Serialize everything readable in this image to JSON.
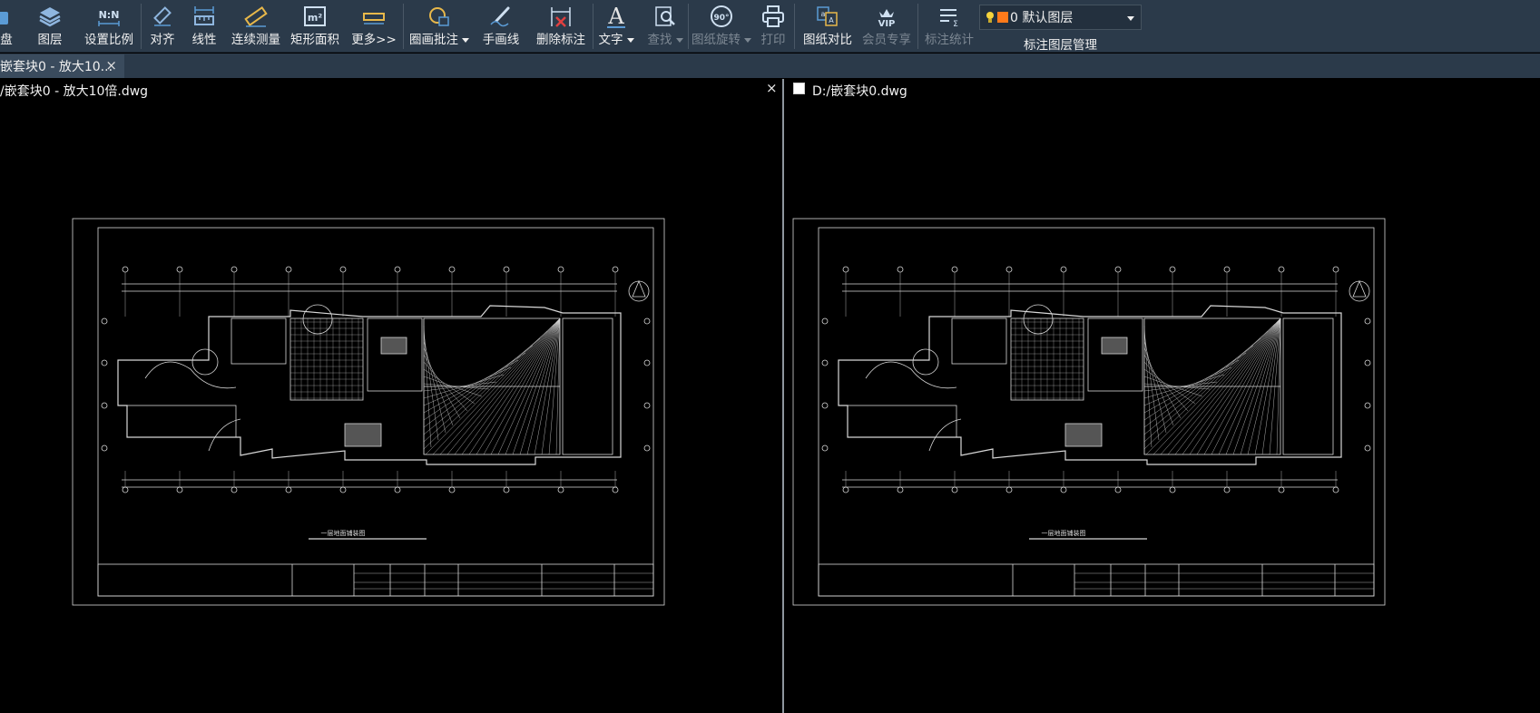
{
  "toolbar": {
    "items": [
      {
        "label": "盘",
        "icon": "disk-icon"
      },
      {
        "label": "图层",
        "icon": "layers-icon"
      },
      {
        "label": "设置比例",
        "icon": "scale-icon",
        "icon_text": "N:N"
      },
      {
        "label": "对齐",
        "icon": "align-icon"
      },
      {
        "label": "线性",
        "icon": "linear-dimension-icon"
      },
      {
        "label": "连续测量",
        "icon": "continuous-measure-icon"
      },
      {
        "label": "矩形面积",
        "icon": "rect-area-icon",
        "icon_text": "m²"
      },
      {
        "label": "更多>>",
        "icon": "more-tools-icon"
      },
      {
        "label": "圈画批注",
        "icon": "circle-annotate-icon"
      },
      {
        "label": "手画线",
        "icon": "freehand-icon"
      },
      {
        "label": "删除标注",
        "icon": "delete-annotation-icon"
      },
      {
        "label": "文字",
        "icon": "text-icon",
        "icon_text": "A"
      },
      {
        "label": "查找",
        "icon": "find-icon"
      },
      {
        "label": "图纸旋转",
        "icon": "rotate-icon",
        "icon_text": "90°"
      },
      {
        "label": "打印",
        "icon": "print-icon"
      },
      {
        "label": "图纸对比",
        "icon": "compare-icon"
      },
      {
        "label": "会员专享",
        "icon": "vip-icon",
        "icon_text": "VIP"
      },
      {
        "label": "标注统计",
        "icon": "annotation-stats-icon"
      }
    ],
    "layer_select": {
      "value": "0 默认图层",
      "color": "#ff7a1a"
    },
    "layer_manage_label": "标注图层管理"
  },
  "tab": {
    "label": "嵌套块0 - 放大10...",
    "close": "×"
  },
  "panes": {
    "left": {
      "title": "/嵌套块0 - 放大10倍.dwg",
      "close": "×"
    },
    "right": {
      "title": "D:/嵌套块0.dwg"
    }
  },
  "drawing": {
    "caption": "一层地面铺装图"
  },
  "colors": {
    "toolbar_bg": "#2b3a4a",
    "icon_blue": "#5b9bd5",
    "icon_yellow": "#e8b84a",
    "canvas_bg": "#000000"
  }
}
